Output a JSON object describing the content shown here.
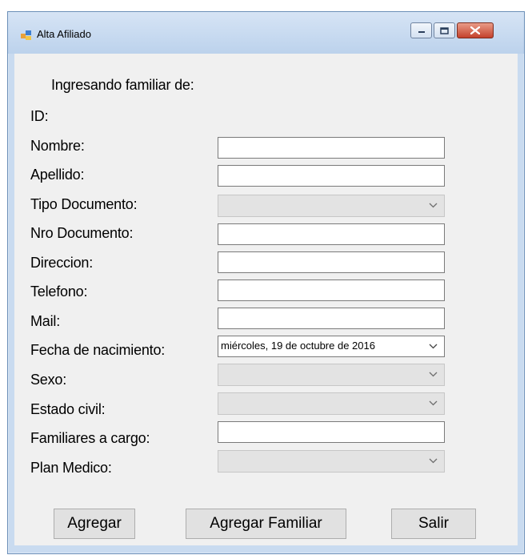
{
  "window": {
    "title": "Alta Afiliado"
  },
  "form": {
    "heading": "Ingresando familiar de:",
    "id_label": "ID:",
    "fields": {
      "nombre": {
        "label": "Nombre:",
        "value": ""
      },
      "apellido": {
        "label": "Apellido:",
        "value": ""
      },
      "tipo_documento": {
        "label": "Tipo Documento:",
        "value": ""
      },
      "nro_documento": {
        "label": "Nro Documento:",
        "value": ""
      },
      "direccion": {
        "label": "Direccion:",
        "value": ""
      },
      "telefono": {
        "label": "Telefono:",
        "value": ""
      },
      "mail": {
        "label": "Mail:",
        "value": ""
      },
      "fecha_nacimiento": {
        "label": "Fecha de nacimiento:",
        "value": "miércoles, 19 de   octubre   de 2016"
      },
      "sexo": {
        "label": "Sexo:",
        "value": ""
      },
      "estado_civil": {
        "label": "Estado civil:",
        "value": ""
      },
      "familiares_cargo": {
        "label": "Familiares a cargo:",
        "value": ""
      },
      "plan_medico": {
        "label": "Plan Medico:",
        "value": ""
      }
    }
  },
  "buttons": {
    "agregar": "Agregar",
    "agregar_familiar": "Agregar Familiar",
    "salir": "Salir"
  },
  "icons": {
    "app": "form-window-icon",
    "minimize": "minimize-icon",
    "maximize": "maximize-icon",
    "close": "close-icon",
    "dropdown": "chevron-down-icon"
  },
  "colors": {
    "title_bar": "#c9dbf0",
    "client_bg": "#f0f0f0",
    "close_button": "#c4412c",
    "disabled_combo": "#e3e3e3"
  }
}
